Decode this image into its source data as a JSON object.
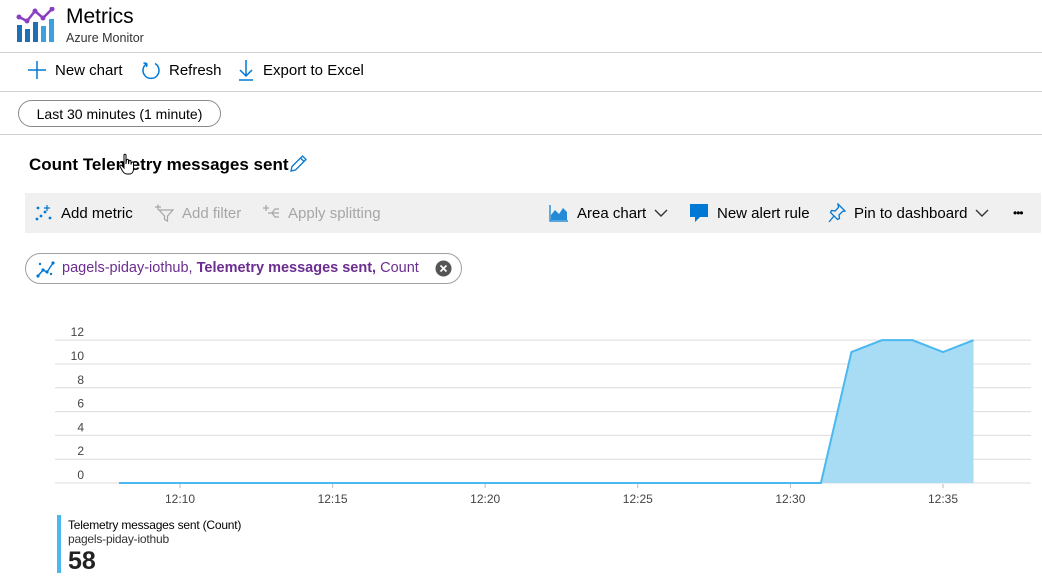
{
  "header": {
    "title": "Metrics",
    "subtitle": "Azure Monitor"
  },
  "commands": {
    "new_chart": "New chart",
    "refresh": "Refresh",
    "export": "Export to Excel"
  },
  "time_range": "Last 30 minutes (1 minute)",
  "chart_title": "Count Telemetry messages sent",
  "toolbar": {
    "add_metric": "Add metric",
    "add_filter": "Add filter",
    "apply_splitting": "Apply splitting",
    "chart_type": "Area chart",
    "new_alert": "New alert rule",
    "pin": "Pin to dashboard",
    "more": "•••"
  },
  "metric_tag": {
    "resource": "pagels-piday-iothub,",
    "metric": "Telemetry messages sent,",
    "aggregation": "Count"
  },
  "colors": {
    "accent": "#0078d4",
    "area_fill": "#a8dcf5",
    "area_line": "#4cb8f0",
    "tag_text": "#6b2d8f"
  },
  "chart_data": {
    "type": "area",
    "x": [
      "12:08",
      "12:09",
      "12:10",
      "12:11",
      "12:12",
      "12:13",
      "12:14",
      "12:15",
      "12:16",
      "12:17",
      "12:18",
      "12:19",
      "12:20",
      "12:21",
      "12:22",
      "12:23",
      "12:24",
      "12:25",
      "12:26",
      "12:27",
      "12:28",
      "12:29",
      "12:30",
      "12:31",
      "12:32",
      "12:33",
      "12:34",
      "12:35",
      "12:36"
    ],
    "values": [
      0,
      0,
      0,
      0,
      0,
      0,
      0,
      0,
      0,
      0,
      0,
      0,
      0,
      0,
      0,
      0,
      0,
      0,
      0,
      0,
      0,
      0,
      0,
      0,
      11,
      12,
      12,
      11,
      12
    ],
    "x_ticks": [
      "12:10",
      "12:15",
      "12:20",
      "12:25",
      "12:30",
      "12:35"
    ],
    "y_ticks": [
      0,
      2,
      4,
      6,
      8,
      10,
      12
    ],
    "ylim": [
      0,
      12.6
    ],
    "grid": true
  },
  "legend": {
    "name": "Telemetry messages sent (Count)",
    "resource": "pagels-piday-iothub",
    "value": "58"
  }
}
